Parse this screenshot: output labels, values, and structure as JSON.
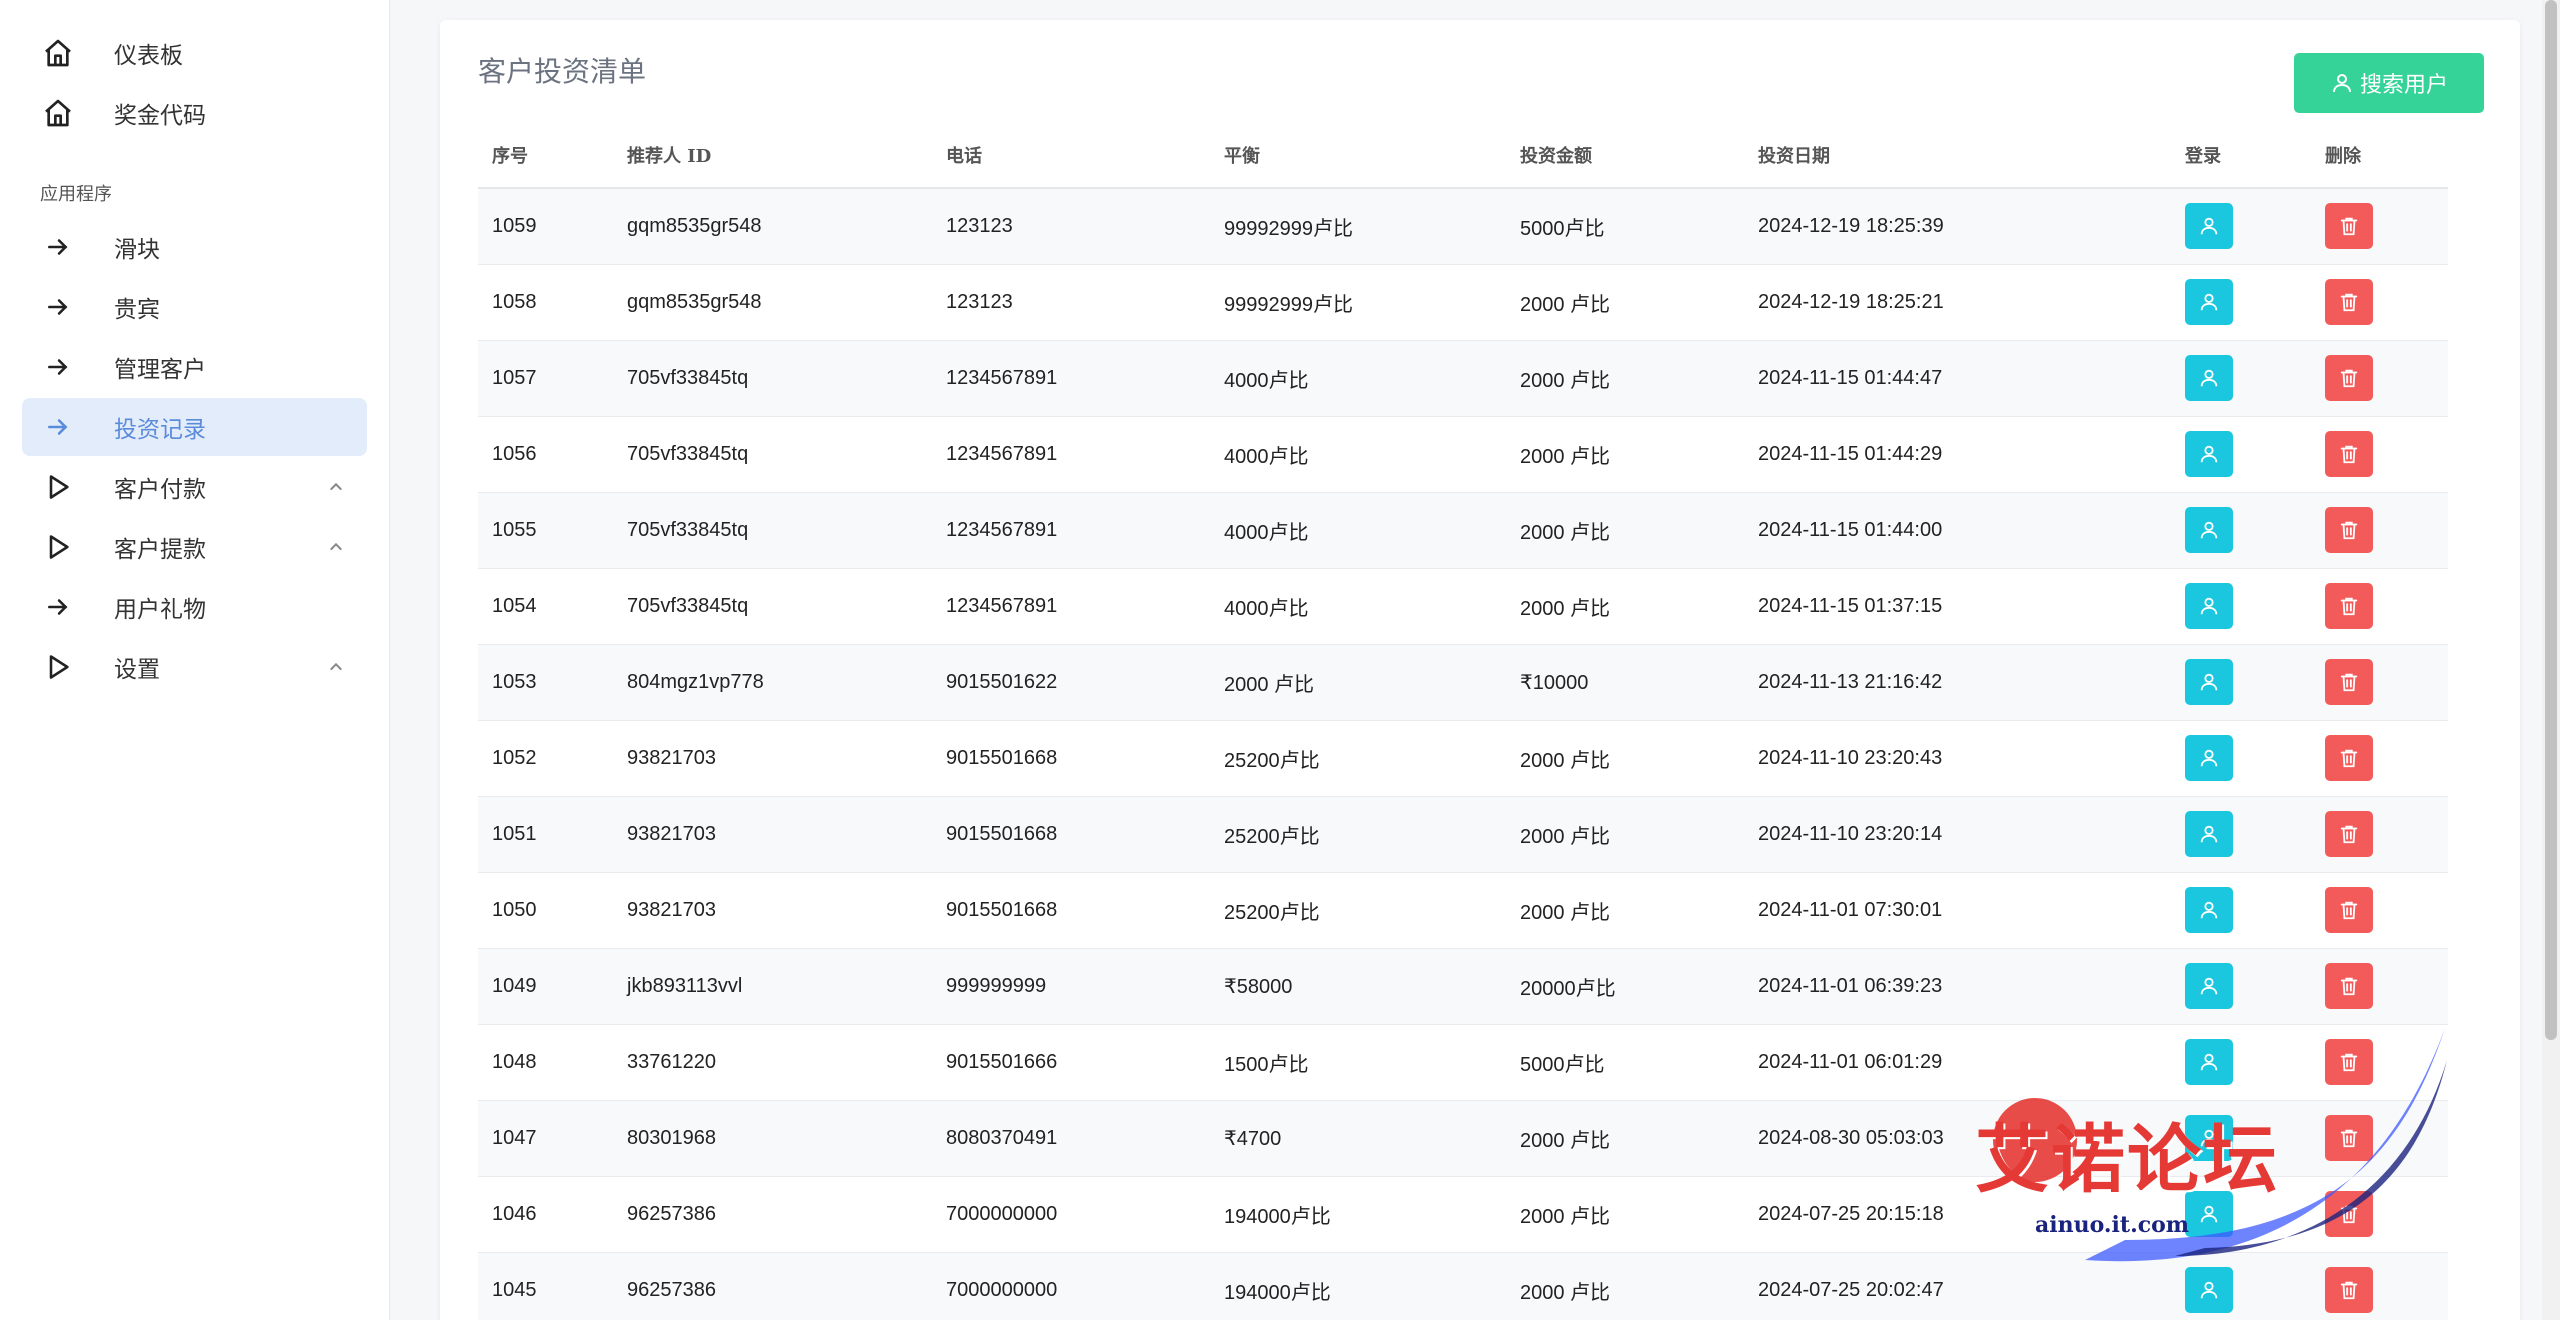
{
  "sidebar": {
    "top_items": [
      {
        "label": "仪表板",
        "icon": "home-icon"
      },
      {
        "label": "奖金代码",
        "icon": "home-icon"
      }
    ],
    "section_label": "应用程序",
    "items": [
      {
        "label": "滑块",
        "icon": "arrow-right-icon",
        "active": false,
        "expandable": false
      },
      {
        "label": "贵宾",
        "icon": "arrow-right-icon",
        "active": false,
        "expandable": false
      },
      {
        "label": "管理客户",
        "icon": "arrow-right-icon",
        "active": false,
        "expandable": false
      },
      {
        "label": "投资记录",
        "icon": "arrow-right-icon",
        "active": true,
        "expandable": false
      },
      {
        "label": "客户付款",
        "icon": "play-icon",
        "active": false,
        "expandable": true
      },
      {
        "label": "客户提款",
        "icon": "play-icon",
        "active": false,
        "expandable": true
      },
      {
        "label": "用户礼物",
        "icon": "arrow-right-icon",
        "active": false,
        "expandable": false
      },
      {
        "label": "设置",
        "icon": "play-icon",
        "active": false,
        "expandable": true
      }
    ]
  },
  "main": {
    "title": "客户投资清单",
    "search_button": "搜索用户",
    "columns": [
      "序号",
      "推荐人 ID",
      "电话",
      "平衡",
      "投资金额",
      "投资日期",
      "登录",
      "删除"
    ],
    "rows": [
      {
        "id": "1059",
        "ref": "gqm8535gr548",
        "phone": "123123",
        "balance": "99992999卢比",
        "amount": "5000卢比",
        "date": "2024-12-19 18:25:39"
      },
      {
        "id": "1058",
        "ref": "gqm8535gr548",
        "phone": "123123",
        "balance": "99992999卢比",
        "amount": "2000 卢比",
        "date": "2024-12-19 18:25:21"
      },
      {
        "id": "1057",
        "ref": "705vf33845tq",
        "phone": "1234567891",
        "balance": "4000卢比",
        "amount": "2000 卢比",
        "date": "2024-11-15 01:44:47"
      },
      {
        "id": "1056",
        "ref": "705vf33845tq",
        "phone": "1234567891",
        "balance": "4000卢比",
        "amount": "2000 卢比",
        "date": "2024-11-15 01:44:29"
      },
      {
        "id": "1055",
        "ref": "705vf33845tq",
        "phone": "1234567891",
        "balance": "4000卢比",
        "amount": "2000 卢比",
        "date": "2024-11-15 01:44:00"
      },
      {
        "id": "1054",
        "ref": "705vf33845tq",
        "phone": "1234567891",
        "balance": "4000卢比",
        "amount": "2000 卢比",
        "date": "2024-11-15 01:37:15"
      },
      {
        "id": "1053",
        "ref": "804mgz1vp778",
        "phone": "9015501622",
        "balance": "2000 卢比",
        "amount": "₹10000",
        "date": "2024-11-13 21:16:42"
      },
      {
        "id": "1052",
        "ref": "93821703",
        "phone": "9015501668",
        "balance": "25200卢比",
        "amount": "2000 卢比",
        "date": "2024-11-10 23:20:43"
      },
      {
        "id": "1051",
        "ref": "93821703",
        "phone": "9015501668",
        "balance": "25200卢比",
        "amount": "2000 卢比",
        "date": "2024-11-10 23:20:14"
      },
      {
        "id": "1050",
        "ref": "93821703",
        "phone": "9015501668",
        "balance": "25200卢比",
        "amount": "2000 卢比",
        "date": "2024-11-01 07:30:01"
      },
      {
        "id": "1049",
        "ref": "jkb893113vvl",
        "phone": "999999999",
        "balance": "₹58000",
        "amount": "20000卢比",
        "date": "2024-11-01 06:39:23"
      },
      {
        "id": "1048",
        "ref": "33761220",
        "phone": "9015501666",
        "balance": "1500卢比",
        "amount": "5000卢比",
        "date": "2024-11-01 06:01:29"
      },
      {
        "id": "1047",
        "ref": "80301968",
        "phone": "8080370491",
        "balance": "₹4700",
        "amount": "2000 卢比",
        "date": "2024-08-30 05:03:03"
      },
      {
        "id": "1046",
        "ref": "96257386",
        "phone": "7000000000",
        "balance": "194000卢比",
        "amount": "2000 卢比",
        "date": "2024-07-25 20:15:18"
      },
      {
        "id": "1045",
        "ref": "96257386",
        "phone": "7000000000",
        "balance": "194000卢比",
        "amount": "2000 卢比",
        "date": "2024-07-25 20:02:47"
      }
    ]
  },
  "watermark": {
    "text": "艾诺论坛",
    "url": "ainuo.it.com"
  },
  "colors": {
    "accent": "#5b8bdb",
    "active_bg": "#e3ecfb",
    "search": "#36d399",
    "login": "#1bc6df",
    "delete": "#f35b5b"
  }
}
